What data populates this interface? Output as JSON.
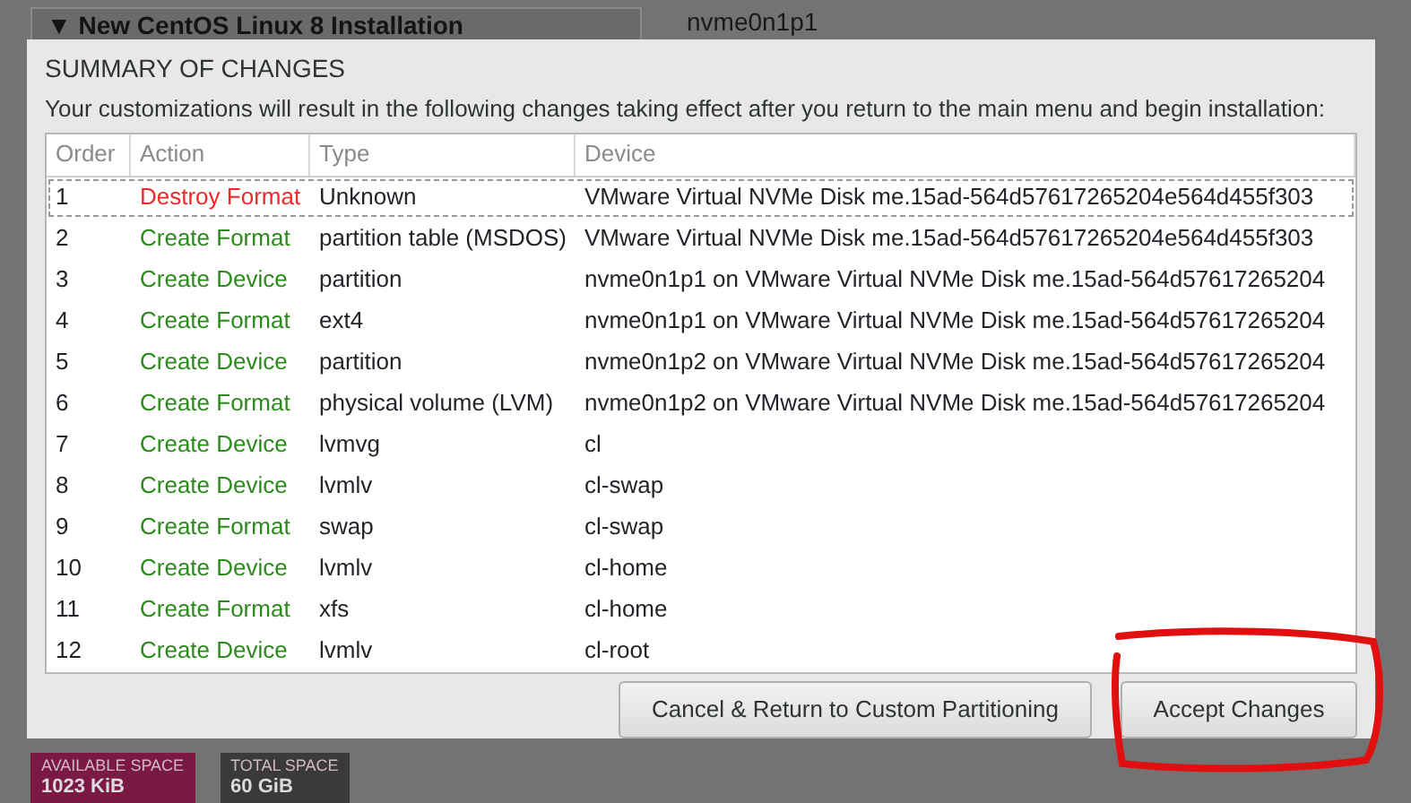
{
  "background": {
    "section_title": "New CentOS Linux 8 Installation",
    "expander": "▼",
    "device_name": "nvme0n1p1",
    "tiles": [
      {
        "label": "AVAILABLE SPACE",
        "value": "1023 KiB",
        "color": "#7a1a44"
      },
      {
        "label": "TOTAL SPACE",
        "value": "60 GiB",
        "color": "#3a3a3a"
      }
    ]
  },
  "dialog": {
    "title": "SUMMARY OF CHANGES",
    "description": "Your customizations will result in the following changes taking effect after you return to the main menu and begin installation:",
    "table": {
      "columns": [
        "Order",
        "Action",
        "Type",
        "Device"
      ],
      "rows": [
        {
          "order": "1",
          "action": "Destroy Format",
          "kind": "destroy",
          "type": "Unknown",
          "device": "VMware Virtual NVMe Disk me.15ad-564d57617265204e564d455f303",
          "focused": true
        },
        {
          "order": "2",
          "action": "Create Format",
          "kind": "create",
          "type": "partition table (MSDOS)",
          "device": "VMware Virtual NVMe Disk me.15ad-564d57617265204e564d455f303",
          "focused": false
        },
        {
          "order": "3",
          "action": "Create Device",
          "kind": "create",
          "type": "partition",
          "device": "nvme0n1p1 on VMware Virtual NVMe Disk me.15ad-564d57617265204",
          "focused": false
        },
        {
          "order": "4",
          "action": "Create Format",
          "kind": "create",
          "type": "ext4",
          "device": "nvme0n1p1 on VMware Virtual NVMe Disk me.15ad-564d57617265204",
          "focused": false
        },
        {
          "order": "5",
          "action": "Create Device",
          "kind": "create",
          "type": "partition",
          "device": "nvme0n1p2 on VMware Virtual NVMe Disk me.15ad-564d57617265204",
          "focused": false
        },
        {
          "order": "6",
          "action": "Create Format",
          "kind": "create",
          "type": "physical volume (LVM)",
          "device": "nvme0n1p2 on VMware Virtual NVMe Disk me.15ad-564d57617265204",
          "focused": false
        },
        {
          "order": "7",
          "action": "Create Device",
          "kind": "create",
          "type": "lvmvg",
          "device": "cl",
          "focused": false
        },
        {
          "order": "8",
          "action": "Create Device",
          "kind": "create",
          "type": "lvmlv",
          "device": "cl-swap",
          "focused": false
        },
        {
          "order": "9",
          "action": "Create Format",
          "kind": "create",
          "type": "swap",
          "device": "cl-swap",
          "focused": false
        },
        {
          "order": "10",
          "action": "Create Device",
          "kind": "create",
          "type": "lvmlv",
          "device": "cl-home",
          "focused": false
        },
        {
          "order": "11",
          "action": "Create Format",
          "kind": "create",
          "type": "xfs",
          "device": "cl-home",
          "focused": false
        },
        {
          "order": "12",
          "action": "Create Device",
          "kind": "create",
          "type": "lvmlv",
          "device": "cl-root",
          "focused": false
        }
      ]
    },
    "buttons": [
      "Cancel & Return to Custom Partitioning",
      "Accept Changes"
    ]
  }
}
